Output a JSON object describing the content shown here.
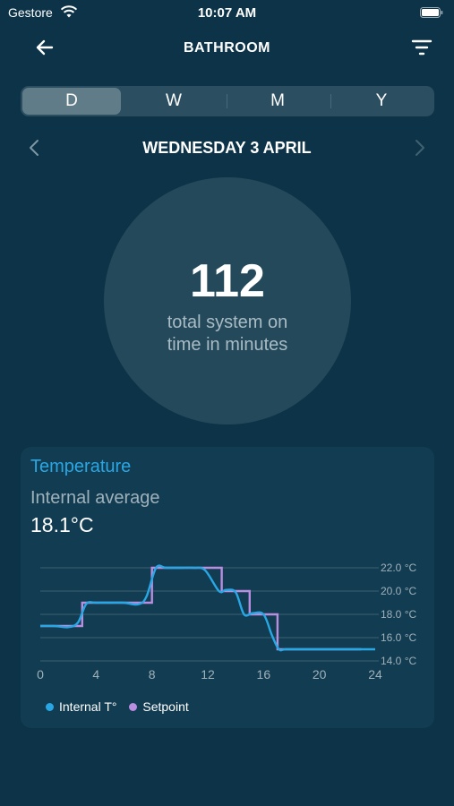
{
  "status_bar": {
    "carrier": "Gestore",
    "time": "10:07 AM"
  },
  "nav": {
    "title": "BATHROOM",
    "back_icon": "arrow-left-icon",
    "filter_icon": "filter-icon"
  },
  "period_tabs": [
    {
      "label": "D",
      "active": true
    },
    {
      "label": "W",
      "active": false
    },
    {
      "label": "M",
      "active": false
    },
    {
      "label": "Y",
      "active": false
    }
  ],
  "date": {
    "label": "WEDNESDAY 3 APRIL"
  },
  "summary": {
    "value": "112",
    "caption_line1": "total system on",
    "caption_line2": "time in minutes"
  },
  "temperature_card": {
    "title": "Temperature",
    "subtitle": "Internal average",
    "value": "18.1°C"
  },
  "colors": {
    "background": "#0c3348",
    "internal": "#29a7e4",
    "setpoint": "#b98ee0",
    "accent_title": "#29a7e4"
  },
  "chart_data": {
    "type": "line",
    "x_ticks": [
      "0",
      "4",
      "8",
      "12",
      "16",
      "20",
      "24"
    ],
    "y_ticks": [
      "22.0 °C",
      "20.0 °C",
      "18.0 °C",
      "16.0 °C",
      "14.0 °C"
    ],
    "xlim": [
      0,
      24
    ],
    "ylim": [
      14,
      22
    ],
    "grid": true,
    "legend_position": "bottom-left",
    "legend": [
      "Internal T°",
      "Setpoint"
    ],
    "series": [
      {
        "name": "Internal T°",
        "color": "#29a7e4",
        "x": [
          0,
          1,
          2,
          2.7,
          3.3,
          4,
          5,
          6,
          7,
          7.6,
          8.3,
          9,
          10,
          11,
          11.8,
          12.8,
          13.3,
          14,
          14.6,
          15.2,
          16,
          16.6,
          17.1,
          17.6,
          19,
          21,
          23,
          24
        ],
        "y": [
          17.0,
          17.0,
          16.9,
          17.3,
          18.9,
          19.0,
          19.0,
          19.0,
          18.85,
          19.5,
          22.0,
          22.0,
          22.0,
          22.0,
          21.8,
          20.0,
          20.1,
          19.9,
          18.0,
          18.1,
          18.0,
          16.2,
          15.0,
          15.0,
          15.0,
          15.0,
          15.0,
          15.0
        ]
      },
      {
        "name": "Setpoint",
        "color": "#b98ee0",
        "x": [
          0,
          3,
          3,
          8,
          8,
          13,
          13,
          15,
          15,
          17,
          17,
          23
        ],
        "y": [
          17,
          17,
          19,
          19,
          22,
          22,
          20,
          20,
          18,
          18,
          15,
          15
        ]
      }
    ]
  }
}
